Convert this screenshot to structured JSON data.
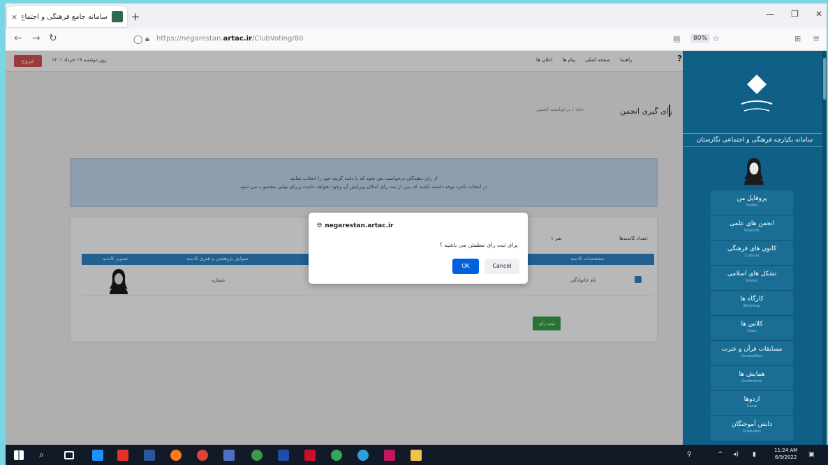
{
  "browser": {
    "tab_title": "سامانه جامع فرهنگی و اجتماع...",
    "tab_close": "×",
    "new_tab": "+",
    "url_prefix": "https://negarestan.",
    "url_domain": "artac.ir",
    "url_suffix": "/ClubVoting/80",
    "zoom": "80%"
  },
  "topbar": {
    "exit_label": "خروج",
    "welcome": "روز دوشنبه ۱۹ خرداد ۱۴۰۱",
    "help": "?",
    "nav": [
      "راهنما",
      "صفحه اصلی",
      "پیام ها",
      "اعلان ها"
    ]
  },
  "content": {
    "heading": "رای گیری انجمن",
    "breadcrumb": "خانه / درخواست انجمن",
    "info_line1": "از رای دهندگان درخواست می شود که با دقت گزینه خود را انتخاب نمایند",
    "info_line2": "در انتخاب نامزد توجه داشته باشید که پس از ثبت رای امکان ویرایش آن وجود نخواهد داشت و رای نهایی محسوب می شود",
    "candidates_label": "تعداد کاندیدها:",
    "candidates_count": "۱ نفر",
    "table": {
      "headers": [
        "تصویر کاندید",
        "سوابق پژوهشی و هنری کاندید",
        "",
        "مشخصات کاندید"
      ],
      "row": {
        "col2": "شماره",
        "col4": "نام خانوادگی"
      }
    },
    "submit_label": "ثبت رای"
  },
  "sidebar": {
    "system_title": "سامانه یکپارچه فرهنگی و اجتماعی نگارستان",
    "menu": [
      {
        "title": "پروفایل من",
        "sub": "Profile"
      },
      {
        "title": "انجمن های علمی",
        "sub": "Scientific"
      },
      {
        "title": "کانون های فرهنگی",
        "sub": "Cultural"
      },
      {
        "title": "تشکل های اسلامی",
        "sub": "Islamic"
      },
      {
        "title": "کارگاه ها",
        "sub": "Workshop"
      },
      {
        "title": "کلاس ها",
        "sub": "Class"
      },
      {
        "title": "مسابقات قرآن و عترت",
        "sub": "Competition"
      },
      {
        "title": "همایش ها",
        "sub": "Conference"
      },
      {
        "title": "اردوها",
        "sub": "Camp"
      },
      {
        "title": "دانش آموختگان",
        "sub": "Graduates"
      }
    ]
  },
  "dialog": {
    "origin": "negarestan.artac.ir",
    "message": "برای ثبت رای مطمئن می باشید ؟",
    "ok_label": "OK",
    "cancel_label": "Cancel"
  },
  "taskbar": {
    "time": "11:24 AM",
    "date": "6/9/2022"
  },
  "colors": {
    "sidebar": "#0f5f86",
    "table_header": "#2f86c6",
    "submit": "#3aa14a",
    "exit": "#d9534f",
    "ok_button": "#0061e0"
  }
}
